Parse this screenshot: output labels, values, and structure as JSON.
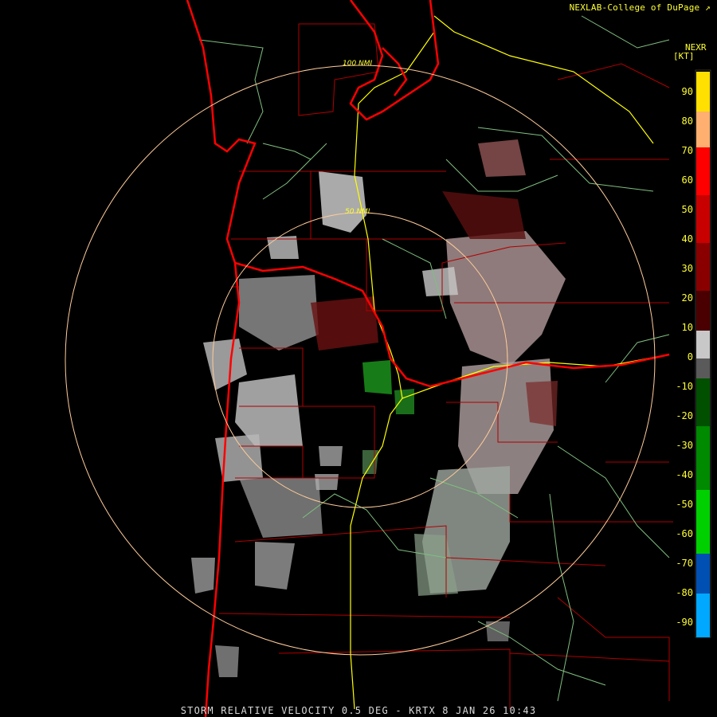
{
  "header": {
    "credit": "NEXLAB-College of DuPage",
    "credit_icon": "external-link-icon",
    "product_code": "NEXR",
    "units": "[KT]"
  },
  "footer": {
    "caption": "STORM RELATIVE VELOCITY 0.5 DEG - KRTX 8 JAN 26 10:43"
  },
  "range_rings": [
    {
      "label": "100 NMI"
    },
    {
      "label": "50 NMI"
    }
  ],
  "legend": {
    "ticks": [
      "90",
      "80",
      "70",
      "60",
      "50",
      "40",
      "30",
      "20",
      "10",
      "0",
      "-10",
      "-20",
      "-30",
      "-40",
      "-50",
      "-60",
      "-70",
      "-80",
      "-90"
    ],
    "colors": [
      "#ffd700",
      "#ffd36a",
      "#f08080",
      "#ff0000",
      "#c80000",
      "#a00000",
      "#780000",
      "#4a0000",
      "#c0c0c0",
      "#707070",
      "#003c00",
      "#008000",
      "#00c000",
      "#00e000",
      "#0050b4",
      "#00a0ff"
    ]
  },
  "colors": {
    "background": "#000000",
    "state_border": "#ff0000",
    "county_border": "#b00000",
    "highway": "#ffff00",
    "river": "#7fbf7f",
    "ring": "#ffcc99",
    "inbound": "#1a8a1a",
    "outbound": "#8a1010",
    "weak_echo": "#b8b8b8"
  }
}
